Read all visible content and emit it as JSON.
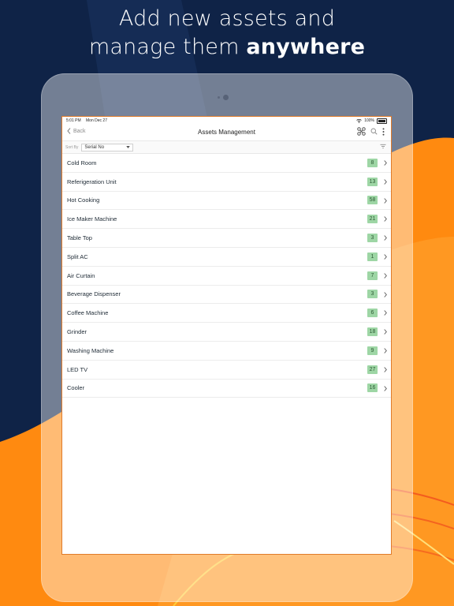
{
  "headline": {
    "line1": "Add new assets and",
    "line2_prefix": "manage them ",
    "line2_bold": "anywhere"
  },
  "colors": {
    "navy": "#0f2347",
    "orange": "#ff8a10",
    "badge_green": "#9ed6a5"
  },
  "status_bar": {
    "time": "5:01 PM",
    "date": "Mon Dec 27",
    "battery": "100%"
  },
  "nav": {
    "back_label": "Back",
    "title": "Assets Management",
    "icons": [
      "qr-scan-icon",
      "search-icon",
      "more-vertical-icon"
    ]
  },
  "sort": {
    "label": "Sort By",
    "selected": "Serial No"
  },
  "assets": [
    {
      "name": "Cold Room",
      "count": "8"
    },
    {
      "name": "Referigeration Unit",
      "count": "13"
    },
    {
      "name": "Hot Cooking",
      "count": "58"
    },
    {
      "name": "Ice Maker Machine",
      "count": "21"
    },
    {
      "name": "Table Top",
      "count": "3"
    },
    {
      "name": "Split AC",
      "count": "1"
    },
    {
      "name": "Air Curtain",
      "count": "7"
    },
    {
      "name": "Beverage Dispenser",
      "count": "3"
    },
    {
      "name": "Coffee Machine",
      "count": "6"
    },
    {
      "name": "Grinder",
      "count": "18"
    },
    {
      "name": "Washing Machine",
      "count": "9"
    },
    {
      "name": "LED TV",
      "count": "27"
    },
    {
      "name": "Cooler",
      "count": "16"
    }
  ]
}
